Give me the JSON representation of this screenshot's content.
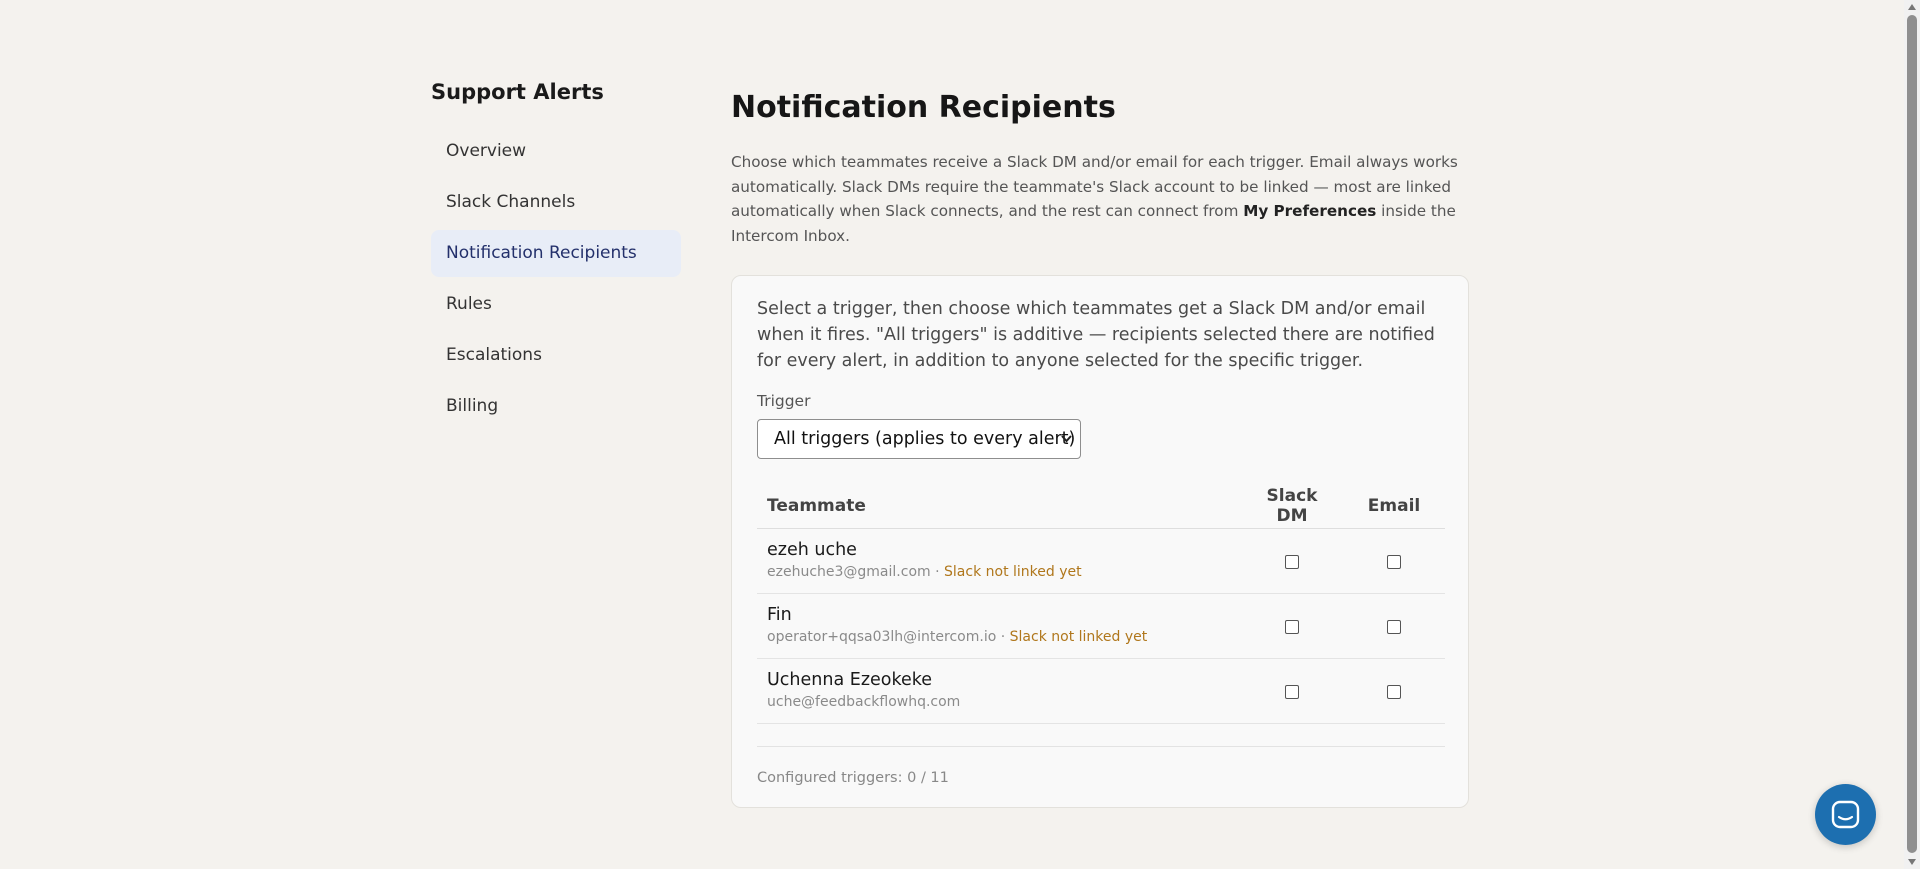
{
  "sidebar": {
    "title": "Support Alerts",
    "items": [
      {
        "label": "Overview",
        "active": false
      },
      {
        "label": "Slack Channels",
        "active": false
      },
      {
        "label": "Notification Recipients",
        "active": true
      },
      {
        "label": "Rules",
        "active": false
      },
      {
        "label": "Escalations",
        "active": false
      },
      {
        "label": "Billing",
        "active": false
      }
    ]
  },
  "main": {
    "title": "Notification Recipients",
    "intro_1": "Choose which teammates receive a Slack DM and/or email for each trigger. Email always works automatically. Slack DMs require the teammate's Slack account to be linked — most are linked automatically when Slack connects, and the rest can connect from ",
    "intro_bold": "My Preferences",
    "intro_2": " inside the Intercom Inbox.",
    "card": {
      "description": "Select a trigger, then choose which teammates get a Slack DM and/or email when it fires. \"All triggers\" is additive — recipients selected there are notified for every alert, in addition to anyone selected for the specific trigger.",
      "trigger_label": "Trigger",
      "trigger_selected": "All triggers (applies to every alert)",
      "columns": {
        "teammate": "Teammate",
        "slack_dm": "Slack DM",
        "email": "Email"
      },
      "rows": [
        {
          "name": "ezeh uche",
          "email": "ezehuche3@gmail.com",
          "separator": " · ",
          "status": "Slack not linked yet",
          "slack_dm": false,
          "email_checked": false
        },
        {
          "name": "Fin",
          "email": "operator+qqsa03lh@intercom.io",
          "separator": " · ",
          "status": "Slack not linked yet",
          "slack_dm": false,
          "email_checked": false
        },
        {
          "name": "Uchenna Ezeokeke",
          "email": "uche@feedbackflowhq.com",
          "separator": "",
          "status": "",
          "slack_dm": false,
          "email_checked": false
        }
      ],
      "footer": "Configured triggers: 0 / 11"
    }
  },
  "colors": {
    "background": "#f4f2ee",
    "active_nav_bg": "#e8edf7",
    "active_nav_text": "#23306b",
    "warning": "#b0771c",
    "launcher": "#1d6fb0"
  },
  "icons": {
    "launcher": "messenger-icon",
    "select": "chevron-down-icon"
  }
}
